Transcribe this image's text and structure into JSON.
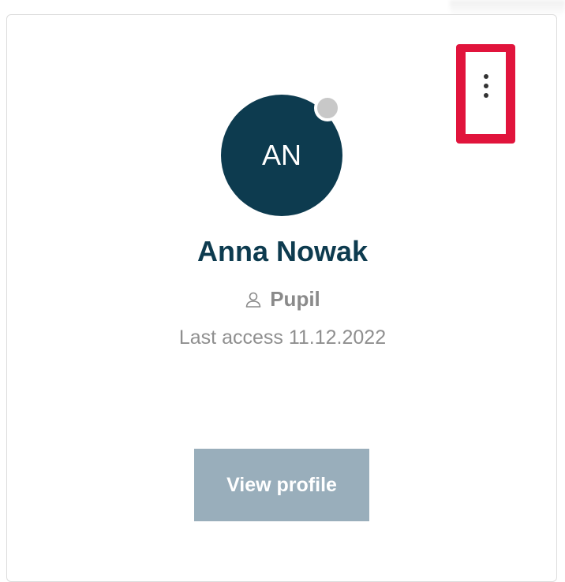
{
  "user": {
    "initials": "AN",
    "name": "Anna Nowak",
    "role": "Pupil",
    "last_access": "Last access 11.12.2022",
    "status": "offline"
  },
  "actions": {
    "view_profile_label": "View profile",
    "more_menu_icon": "kebab-vertical-icon"
  },
  "colors": {
    "avatar_bg": "#0d3b4f",
    "name_text": "#0d3b4f",
    "button_bg": "#99aebb",
    "highlight": "#e1143c",
    "status_dot": "#c8c8c8"
  }
}
